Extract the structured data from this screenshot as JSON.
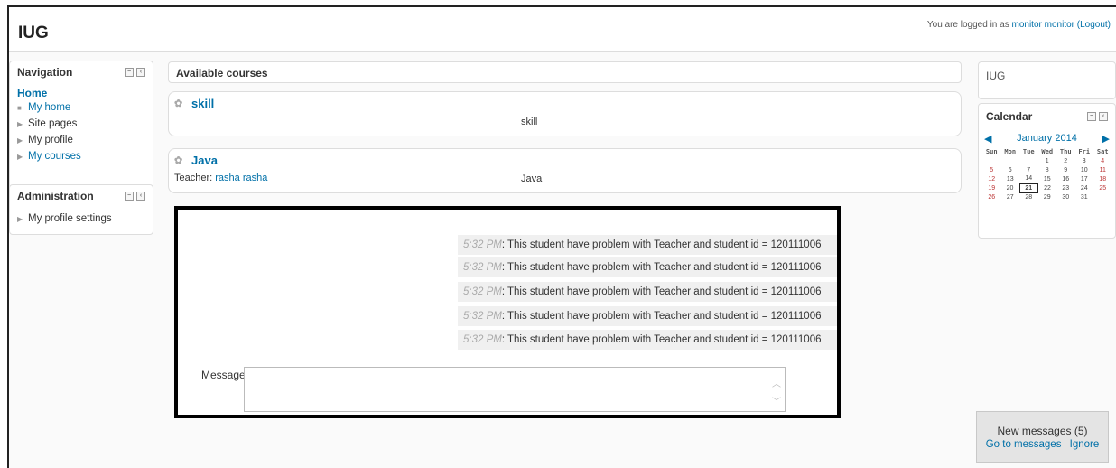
{
  "header": {
    "site_title": "IUG",
    "login_prefix": "You are logged in as",
    "login_user": "monitor monitor",
    "logout_label": "(Logout)"
  },
  "navigation": {
    "title": "Navigation",
    "home": "Home",
    "items": [
      {
        "label": "My home",
        "icon": "bullet"
      },
      {
        "label": "Site pages",
        "icon": "arrow-right"
      },
      {
        "label": "My profile",
        "icon": "arrow-right"
      },
      {
        "label": "My courses",
        "icon": "arrow-right"
      }
    ]
  },
  "administration": {
    "title": "Administration",
    "items": [
      {
        "label": "My profile settings"
      }
    ]
  },
  "courses": {
    "heading": "Available courses",
    "list": [
      {
        "name": "skill",
        "teacher_label": "",
        "teacher": "",
        "summary": "skill"
      },
      {
        "name": "Java",
        "teacher_label": "Teacher:",
        "teacher": "rasha rasha",
        "summary": "Java"
      }
    ]
  },
  "chat": {
    "messages": [
      {
        "time": "5:32 PM",
        "text": ": This student have problem with Teacher and student id = 120111006"
      },
      {
        "time": "5:32 PM",
        "text": ": This student have problem with Teacher and student id = 120111006"
      },
      {
        "time": "5:32 PM",
        "text": ": This student have problem with Teacher and student id = 120111006"
      },
      {
        "time": "5:32 PM",
        "text": ": This student have problem with Teacher and student id = 120111006"
      },
      {
        "time": "5:32 PM",
        "text": ": This student have problem with Teacher and student id = 120111006"
      }
    ],
    "message_label": "Message",
    "message_value": ""
  },
  "right_blocks": {
    "site_label": "IUG"
  },
  "calendar": {
    "title": "Calendar",
    "month": "January 2014",
    "weekdays": [
      "Sun",
      "Mon",
      "Tue",
      "Wed",
      "Thu",
      "Fri",
      "Sat"
    ],
    "weeks": [
      [
        "",
        "",
        "",
        "1",
        "2",
        "3",
        "4"
      ],
      [
        "5",
        "6",
        "7",
        "8",
        "9",
        "10",
        "11"
      ],
      [
        "12",
        "13",
        "14",
        "15",
        "16",
        "17",
        "18"
      ],
      [
        "19",
        "20",
        "21",
        "22",
        "23",
        "24",
        "25"
      ],
      [
        "26",
        "27",
        "28",
        "29",
        "30",
        "31",
        ""
      ]
    ],
    "today": "21"
  },
  "notification": {
    "title": "New messages (5)",
    "go_label": "Go to messages",
    "ignore_label": "Ignore"
  },
  "colors": {
    "link": "#0070a8",
    "frame_border": "#222222",
    "weekend": "#bb3333"
  }
}
